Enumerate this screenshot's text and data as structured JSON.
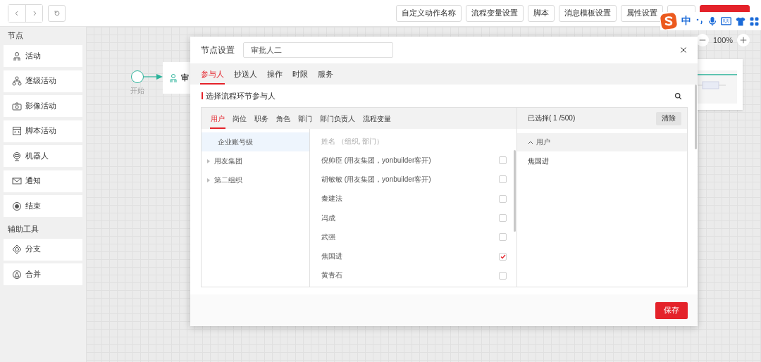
{
  "toolbar": {
    "buttons": [
      {
        "label": "自定义动作名称",
        "kind": "plain"
      },
      {
        "label": "流程变量设置",
        "kind": "plain"
      },
      {
        "label": "脚本",
        "kind": "plain"
      },
      {
        "label": "消息模板设置",
        "kind": "plain"
      },
      {
        "label": "属性设置",
        "kind": "plain"
      },
      {
        "kind": "plain"
      },
      {
        "kind": "primary"
      }
    ]
  },
  "sidebar": {
    "sections": [
      {
        "title": "节点",
        "items": [
          {
            "label": "活动"
          },
          {
            "label": "逐级活动"
          },
          {
            "label": "影像活动"
          },
          {
            "label": "脚本活动"
          },
          {
            "label": "机器人"
          },
          {
            "label": "通知"
          },
          {
            "label": "结束"
          }
        ]
      },
      {
        "title": "辅助工具",
        "items": [
          {
            "label": "分支"
          },
          {
            "label": "合并"
          }
        ]
      }
    ]
  },
  "canvas": {
    "start_label": "开始",
    "node_label": "审",
    "zoom": "100%"
  },
  "ime": {
    "mode": "中"
  },
  "dialog": {
    "title": "节点设置",
    "name_value": "审批人二",
    "tabs": [
      {
        "label": "参与人",
        "selected": true
      },
      {
        "label": "抄送人",
        "selected": false
      },
      {
        "label": "操作",
        "selected": false
      },
      {
        "label": "时限",
        "selected": false
      },
      {
        "label": "服务",
        "selected": false
      }
    ],
    "section_title": "选择流程环节参与人",
    "picker": {
      "tabs": [
        {
          "label": "用户",
          "selected": true
        },
        {
          "label": "岗位",
          "selected": false
        },
        {
          "label": "职务",
          "selected": false
        },
        {
          "label": "角色",
          "selected": false
        },
        {
          "label": "部门",
          "selected": false
        },
        {
          "label": "部门负责人",
          "selected": false
        },
        {
          "label": "流程变量",
          "selected": false
        }
      ],
      "tree": [
        {
          "label": "企业账号级",
          "selected": true,
          "kind": "leaf"
        },
        {
          "label": "用友集团",
          "selected": false,
          "kind": "branch"
        },
        {
          "label": "第二组织",
          "selected": false,
          "kind": "branch"
        }
      ],
      "list_header": "姓名 （组织, 部门）",
      "rows": [
        {
          "name": "倪帅臣 (用友集团，yonbuilder客开)",
          "checked": false
        },
        {
          "name": "胡敏敏 (用友集团，yonbuilder客开)",
          "checked": false
        },
        {
          "name": "秦建法",
          "checked": false
        },
        {
          "name": "冯成",
          "checked": false
        },
        {
          "name": "武强",
          "checked": false
        },
        {
          "name": "焦国进",
          "checked": true
        },
        {
          "name": "黄青石",
          "checked": false
        }
      ],
      "selected_heading": "已选择( 1 /500)",
      "clear_label": "清除",
      "groups": [
        {
          "label": "用户",
          "expanded": true,
          "items": [
            "焦国进"
          ]
        }
      ]
    },
    "save_label": "保存"
  }
}
